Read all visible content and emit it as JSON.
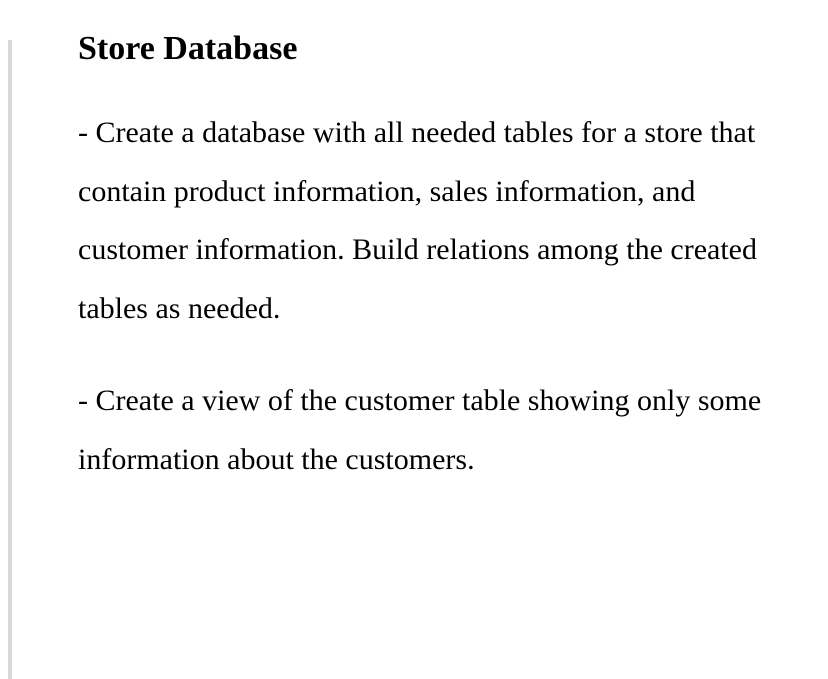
{
  "heading": "Store Database",
  "paragraphs": [
    "- Create a database with all needed tables for a store that contain product information, sales information, and customer information. Build relations among the created tables as needed.",
    "- Create a view of the customer table showing only some information about the customers."
  ]
}
